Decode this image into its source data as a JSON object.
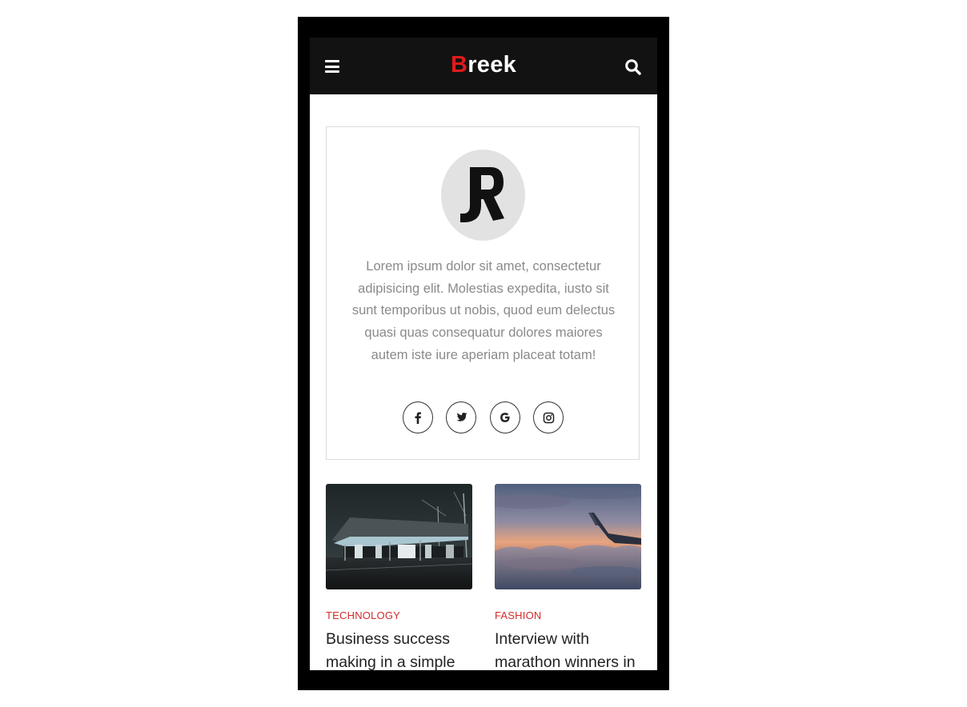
{
  "app": {
    "logo_first": "B",
    "logo_rest": "reek"
  },
  "author": {
    "avatar_initials": "JR",
    "bio": "Lorem ipsum dolor sit amet, consectetur adipisicing elit. Molestias expedita, iusto sit sunt temporibus ut nobis, quod eum delectus quasi quas consequatur dolores maiores autem iste iure aperiam placeat totam!",
    "socials": [
      "facebook-icon",
      "twitter-icon",
      "google-icon",
      "instagram-icon"
    ]
  },
  "posts": [
    {
      "category": "TECHNOLOGY",
      "title": "Business success making in a simple",
      "image": "night-station-photo"
    },
    {
      "category": "FASHION",
      "title": "Interview with marathon winners in",
      "image": "airplane-wing-sunset-photo"
    }
  ],
  "colors": {
    "accent": "#e01a1a",
    "header_bg": "#121212",
    "category": "#d22b2b"
  }
}
